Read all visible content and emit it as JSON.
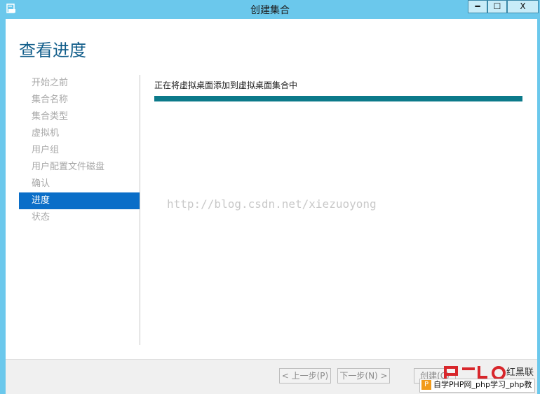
{
  "window": {
    "title": "创建集合",
    "minimize_glyph": "━",
    "maximize_glyph": "☐",
    "close_glyph": "X"
  },
  "page": {
    "title": "查看进度"
  },
  "nav": {
    "items": [
      {
        "label": "开始之前"
      },
      {
        "label": "集合名称"
      },
      {
        "label": "集合类型"
      },
      {
        "label": "虚拟机"
      },
      {
        "label": "用户组"
      },
      {
        "label": "用户配置文件磁盘"
      },
      {
        "label": "确认"
      },
      {
        "label": "进度"
      },
      {
        "label": "状态"
      }
    ],
    "active_index": 7
  },
  "content": {
    "status_text": "正在将虚拟桌面添加到虚拟桌面集合中",
    "progress_percent": 100,
    "progress_color": "#0c7a8a"
  },
  "watermark": {
    "url": "http://blog.csdn.net/xiezuoyong",
    "brand": "红黑联盟",
    "banner": "自学PHP网_php学习_php教"
  },
  "footer": {
    "prev_label": "< 上一步(P)",
    "next_label": "下一步(N) >",
    "create_label": "创建(C)"
  },
  "colors": {
    "accent": "#0a6ec8",
    "title_bar": "#6bc8ec"
  }
}
